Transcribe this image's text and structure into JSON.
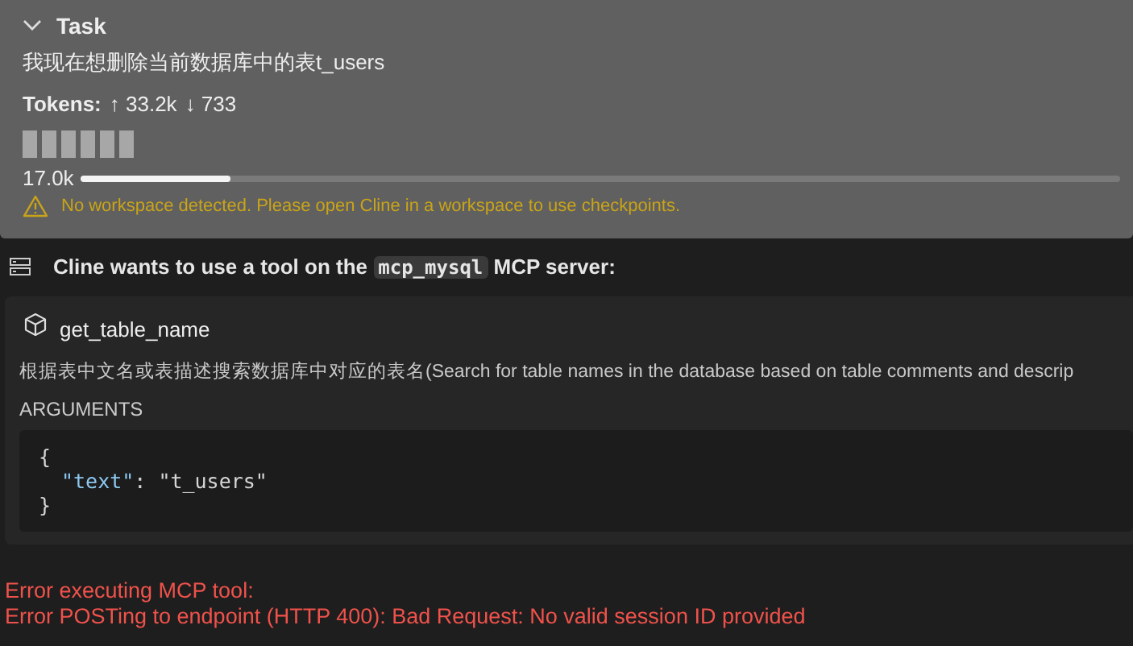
{
  "task": {
    "title": "Task",
    "expanded": true,
    "message": "我现在想删除当前数据库中的表t_users",
    "tokens_label": "Tokens:",
    "tokens_up": "↑ 33.2k",
    "tokens_down": "↓ 733",
    "context": {
      "used": "17.0k",
      "level": 0.145
    },
    "warning": "No workspace detected. Please open Cline in a workspace to use checkpoints."
  },
  "request": {
    "before": "Cline wants to use a tool on the ",
    "server": "mcp_mysql",
    "after": " MCP server:"
  },
  "tool": {
    "name": "get_table_name",
    "description": "根据表中文名或表描述搜索数据库中对应的表名(Search for table names in the database based on table comments and descrip",
    "arguments_label": "ARGUMENTS",
    "open": "{",
    "pairs": [
      {
        "key": "\"text\"",
        "sep": ": ",
        "value": "\"t_users\""
      }
    ],
    "close": "}"
  },
  "errors": [
    "Error executing MCP tool:",
    "Error POSTing to endpoint (HTTP 400): Bad Request: No valid session ID provided"
  ]
}
